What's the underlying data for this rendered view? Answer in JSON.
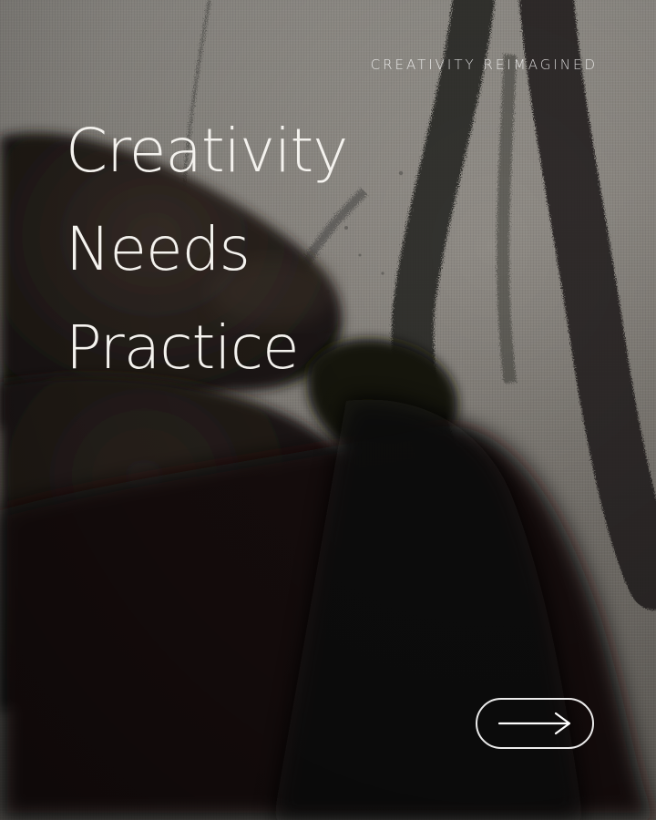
{
  "eyebrow": "CREATIVITY REIMAGINED",
  "headline": {
    "line1": "Creativity",
    "line2": "Needs",
    "line3": "Practice"
  },
  "next_button": {
    "icon": "arrow-right-icon"
  },
  "colors": {
    "text": "#f4f2ee",
    "canvas": "#8f8b85",
    "charcoal": "#2a2826"
  }
}
